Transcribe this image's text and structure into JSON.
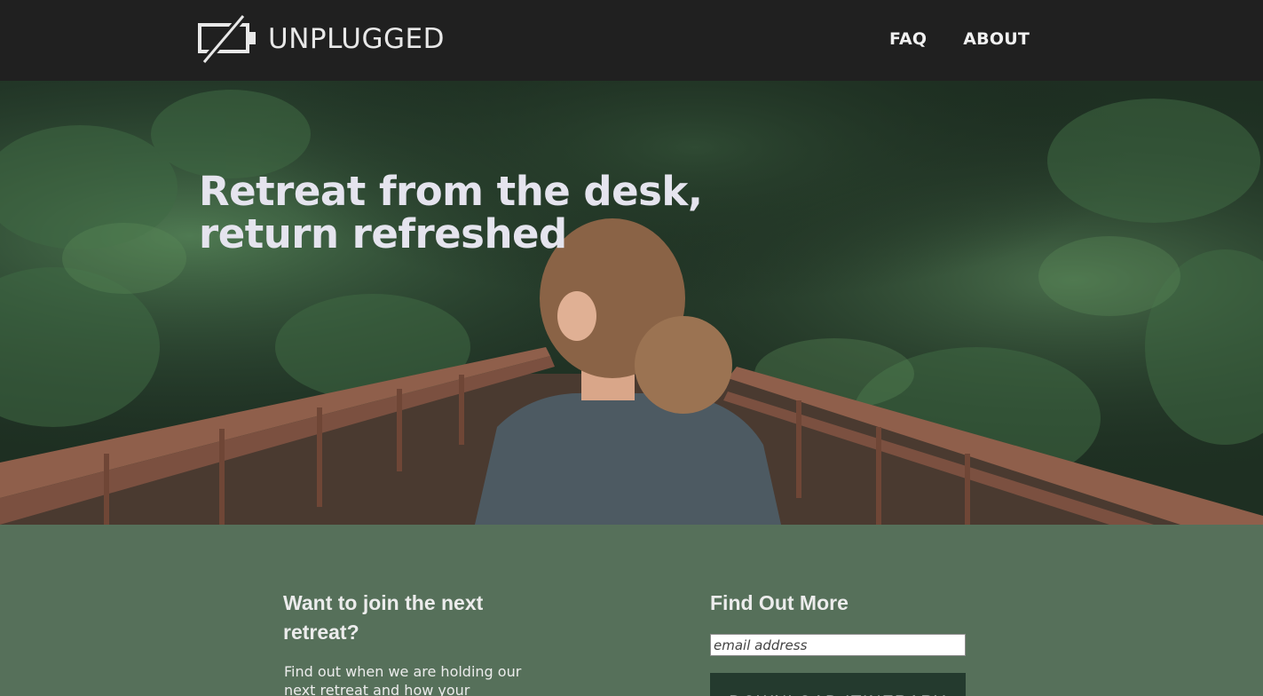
{
  "header": {
    "logo_text": "UNPLUGGED",
    "nav": [
      {
        "label": "FAQ"
      },
      {
        "label": "ABOUT"
      }
    ]
  },
  "hero": {
    "headline_line1": "Retreat from the desk,",
    "headline_line2": "return refreshed"
  },
  "join": {
    "title": "Want to join the next retreat?",
    "text": "Find out when we are holding our next retreat and how your"
  },
  "find_out": {
    "title": "Find Out More",
    "email_placeholder": "email address",
    "download_label": "DOWNLOAD ITINERARY"
  },
  "colors": {
    "topbar": "#202020",
    "section_bg": "#56705a",
    "button_bg": "#243a2e",
    "text_light": "#e5e4ee"
  }
}
